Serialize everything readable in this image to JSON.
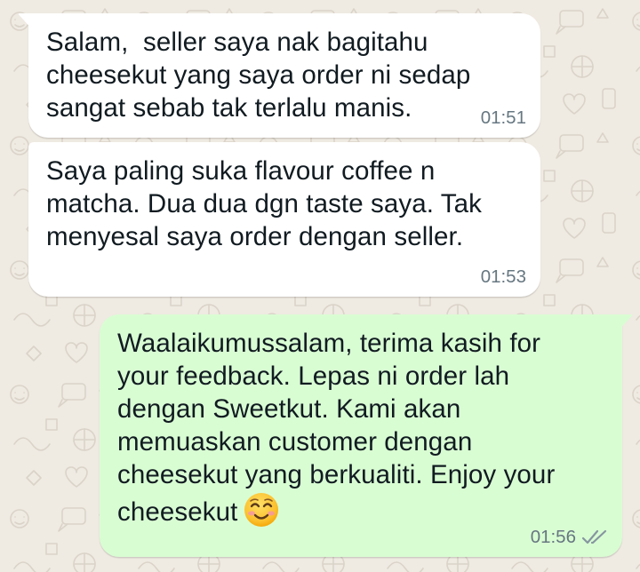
{
  "chat": {
    "messages": [
      {
        "direction": "incoming",
        "text": "Salam,  seller saya nak bagitahu\ncheesekut yang saya order ni sedap\nsangat sebab tak terlalu manis.",
        "time": "01:51"
      },
      {
        "direction": "incoming",
        "text": "Saya paling suka flavour coffee n\nmatcha. Dua dua dgn taste saya. Tak\nmenyesal saya order dengan seller.",
        "time": "01:53"
      },
      {
        "direction": "outgoing",
        "text": "Waalaikumussalam, terima kasih for\nyour feedback. Lepas ni order lah\ndengan Sweetkut. Kami akan\nmemuaskan customer dengan\ncheesekut yang berkualiti. Enjoy your\ncheesekut",
        "emoji": "smiling-face-with-smiling-eyes",
        "time": "01:56",
        "status": "read-double-check"
      }
    ]
  },
  "colors": {
    "wallpaper": "#efeae2",
    "incoming_bubble": "#ffffff",
    "outgoing_bubble": "#d9fdd3",
    "text": "#111b21",
    "meta": "#667781"
  }
}
